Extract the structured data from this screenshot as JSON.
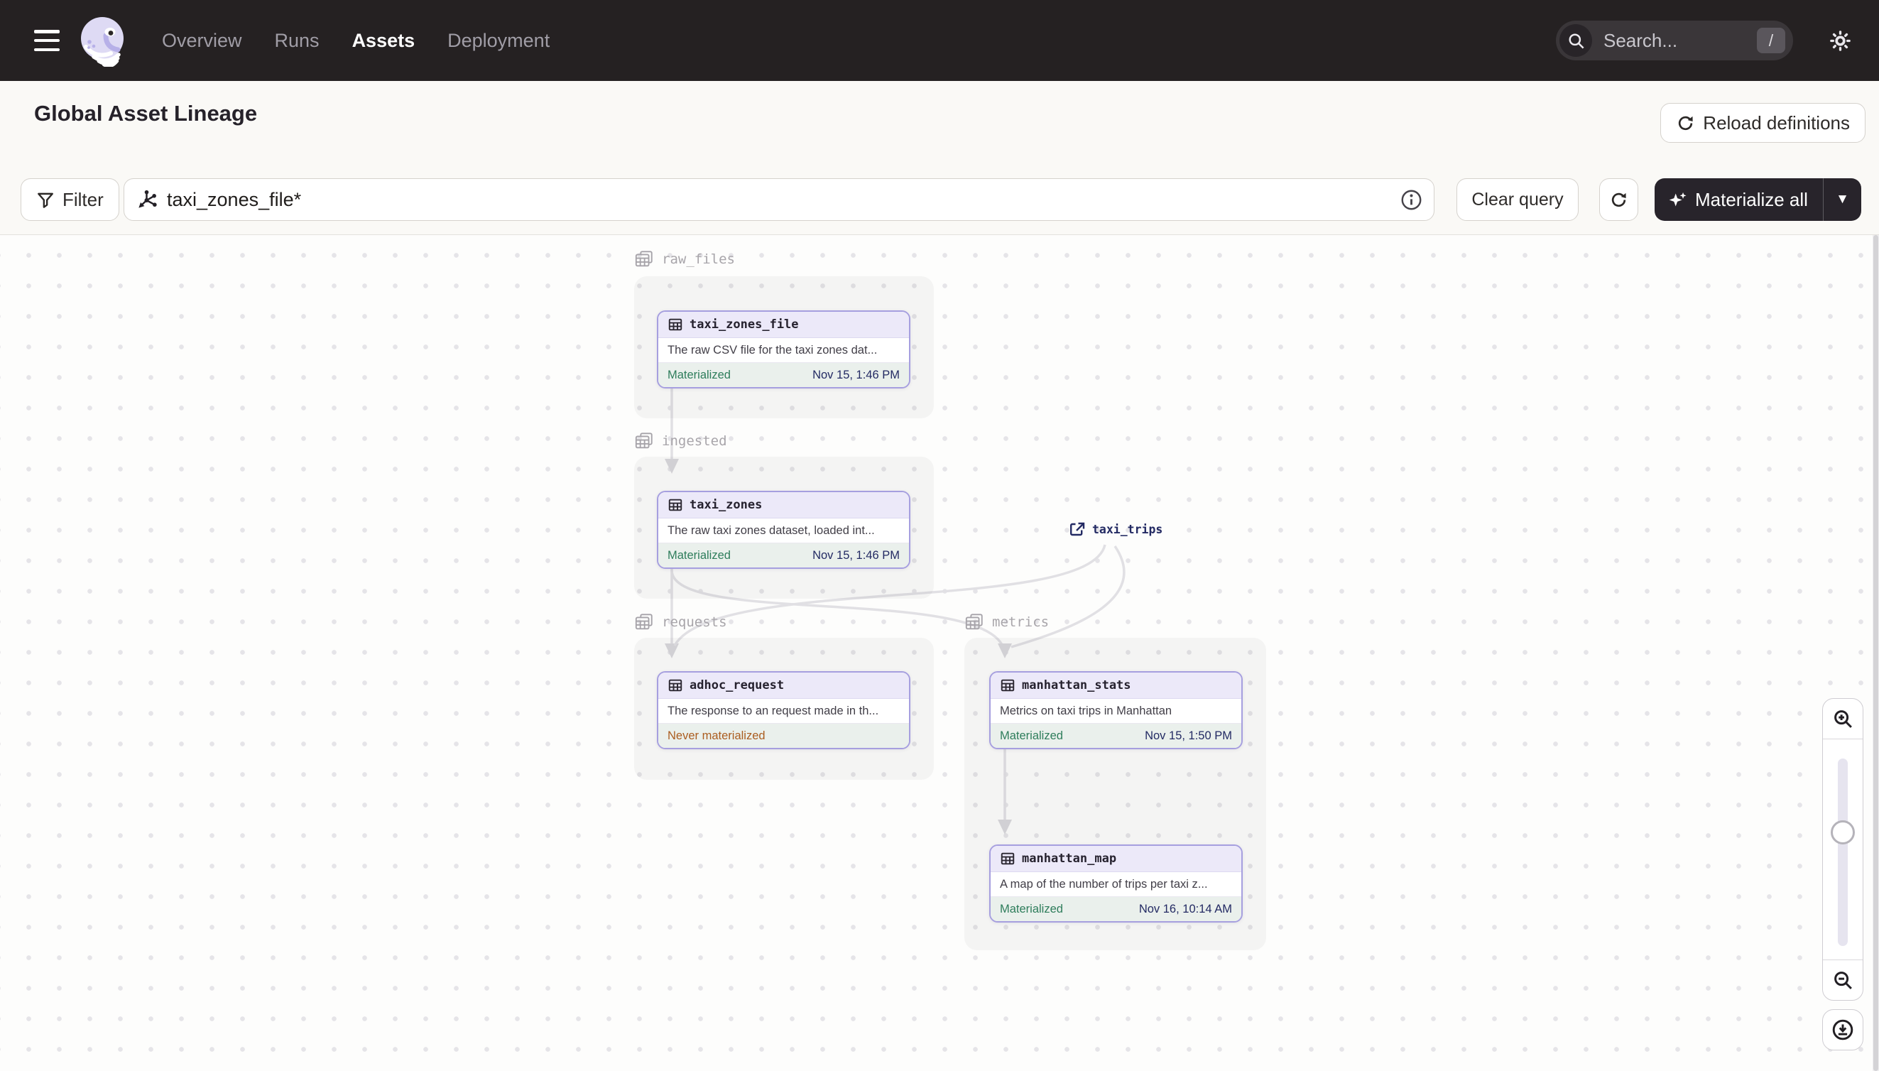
{
  "nav": {
    "links": [
      {
        "label": "Overview",
        "active": false
      },
      {
        "label": "Runs",
        "active": false
      },
      {
        "label": "Assets",
        "active": true
      },
      {
        "label": "Deployment",
        "active": false
      }
    ],
    "search": {
      "placeholder": "Search...",
      "shortcut": "/"
    }
  },
  "header": {
    "title": "Global Asset Lineage",
    "reload_button_label": "Reload definitions"
  },
  "toolbar": {
    "filter_button_label": "Filter",
    "query_input_value": "taxi_zones_file*",
    "clear_query_button_label": "Clear query",
    "materialize_button_label": "Materialize all"
  },
  "graph": {
    "groups": [
      {
        "name": "raw_files"
      },
      {
        "name": "ingested"
      },
      {
        "name": "requests"
      },
      {
        "name": "metrics"
      }
    ],
    "nodes": [
      {
        "name": "taxi_zones_file",
        "group": "raw_files",
        "description": "The raw CSV file for the taxi zones dat...",
        "status": "Materialized",
        "materialized_at": "Nov 15, 1:46 PM"
      },
      {
        "name": "taxi_zones",
        "group": "ingested",
        "description": "The raw taxi zones dataset, loaded int...",
        "status": "Materialized",
        "materialized_at": "Nov 15, 1:46 PM"
      },
      {
        "name": "adhoc_request",
        "group": "requests",
        "description": "The response to an request made in th...",
        "status": "Never materialized",
        "materialized_at": ""
      },
      {
        "name": "manhattan_stats",
        "group": "metrics",
        "description": "Metrics on taxi trips in Manhattan",
        "status": "Materialized",
        "materialized_at": "Nov 15, 1:50 PM"
      },
      {
        "name": "manhattan_map",
        "group": "metrics",
        "description": "A map of the number of trips per taxi z...",
        "status": "Materialized",
        "materialized_at": "Nov 16, 10:14 AM"
      }
    ],
    "external_assets": [
      {
        "name": "taxi_trips"
      }
    ],
    "edges": [
      {
        "from": "taxi_zones_file",
        "to": "taxi_zones"
      },
      {
        "from": "taxi_zones",
        "to": "adhoc_request"
      },
      {
        "from": "taxi_zones",
        "to": "manhattan_stats"
      },
      {
        "from": "taxi_trips",
        "to": "adhoc_request"
      },
      {
        "from": "taxi_trips",
        "to": "manhattan_stats"
      },
      {
        "from": "manhattan_stats",
        "to": "manhattan_map"
      }
    ]
  },
  "colors": {
    "nav_background": "#252122",
    "accent_purple": "#a69fdf",
    "node_header_background": "#ece9f9",
    "materialized_green": "#2e7d5b",
    "never_materialized_orange": "#ab5d20",
    "timestamp_navy": "#232a63",
    "edge_gray": "#e1e0e4"
  }
}
